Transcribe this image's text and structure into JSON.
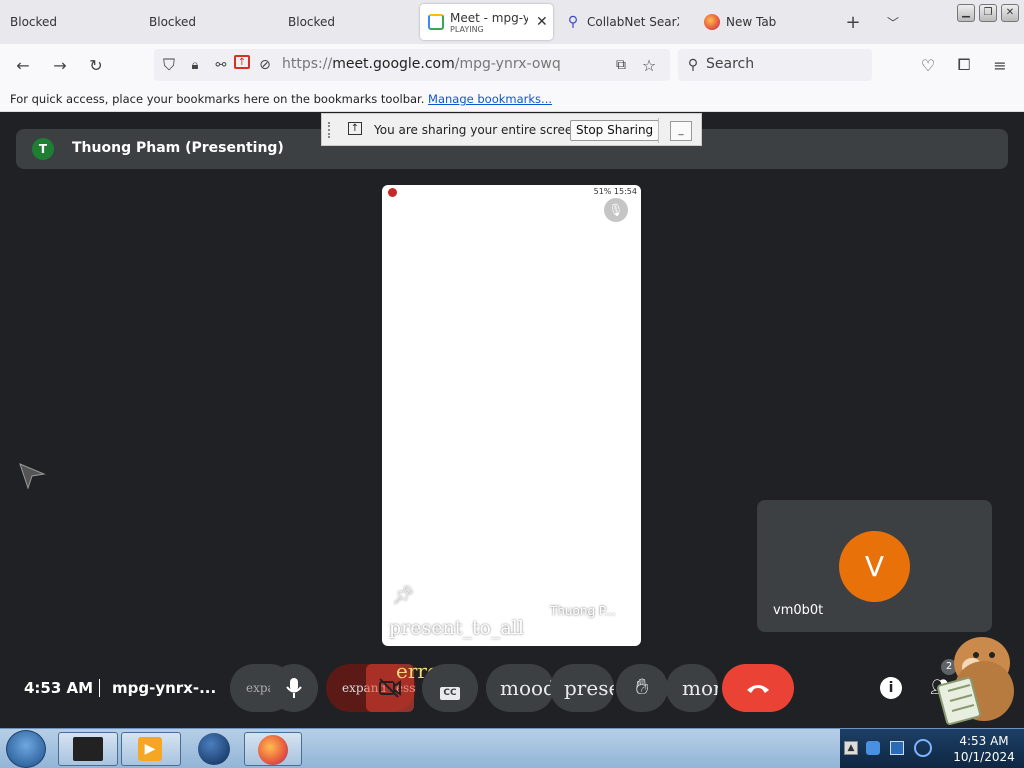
{
  "browser": {
    "tabs": [
      {
        "label": "Blocked"
      },
      {
        "label": "Blocked"
      },
      {
        "label": "Blocked"
      },
      {
        "label": "Meet - mpg-ynrx-owq",
        "sublabel": "PLAYING",
        "active": true
      },
      {
        "label": "CollabNet SearXNG"
      },
      {
        "label": "New Tab"
      }
    ],
    "url_prefix": "https://",
    "url_host": "meet.google.com",
    "url_path": "/mpg-ynrx-owq",
    "search_placeholder": "Search",
    "bookmarks_text": "For quick access, place your bookmarks here on the bookmarks toolbar.",
    "bookmarks_link": "Manage bookmarks..."
  },
  "share_notice": {
    "message": "You are sharing your entire screen.",
    "stop_label": "Stop Sharing",
    "hide_label": "_"
  },
  "meet": {
    "presenter_initial": "T",
    "presenter_label": "Thuong Pham (Presenting)",
    "phone": {
      "status_right": "51% 15:54",
      "caption": "present_to_all",
      "name": "Thuong P..."
    },
    "self": {
      "initial": "V",
      "name": "vm0b0t"
    },
    "time": "4:53 AM",
    "meeting_code": "mpg-ynrx-...",
    "controls": {
      "expand_1": "expand_less",
      "expand_2": "expand_less",
      "error": "error",
      "cc": "CC",
      "mood": "mood",
      "present": "present_to_all",
      "more": "more_vert"
    },
    "people_count": "2"
  },
  "taskbar": {
    "time": "4:53 AM",
    "date": "10/1/2024"
  },
  "colors": {
    "end_call": "#ea4335",
    "avatar_self": "#e8710a",
    "avatar_presenter": "#1e7e34",
    "meet_bg": "#202124"
  }
}
